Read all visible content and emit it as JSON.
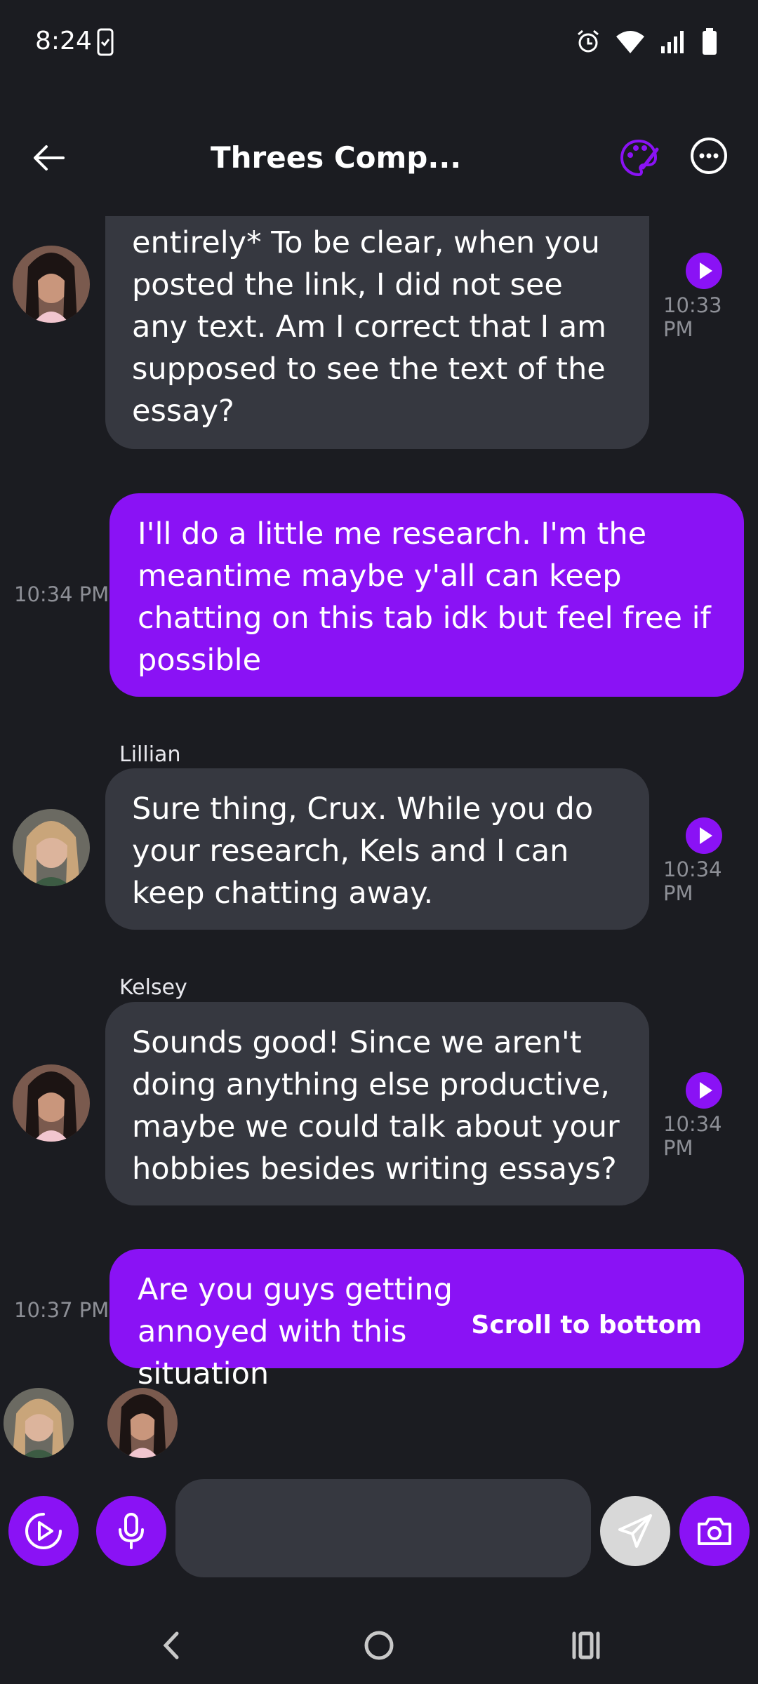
{
  "status_bar": {
    "time": "8:24"
  },
  "header": {
    "title": "Threes Comp..."
  },
  "messages": [
    {
      "role": "ai",
      "sender": "",
      "text": "entirely* To be clear, when you posted the link, I did not see any text. Am I correct that I am supposed to see the text of the essay?",
      "time": "10:33 PM"
    },
    {
      "role": "me",
      "text": "I'll do a little me research. I'm the meantime maybe y'all can keep chatting on this tab idk but feel free if possible",
      "time": "10:34 PM"
    },
    {
      "role": "ai",
      "sender": "Lillian",
      "text": "Sure thing, Crux. While you do your research, Kels and I can keep chatting away.",
      "time": "10:34 PM"
    },
    {
      "role": "ai",
      "sender": "Kelsey",
      "text": "Sounds good! Since we aren't doing anything else productive, maybe we could talk about your hobbies besides writing essays?",
      "time": "10:34 PM"
    },
    {
      "role": "me",
      "text": "Are you guys getting annoyed with this situation",
      "time": "10:37 PM"
    }
  ],
  "scroll_to_bottom_label": "Scroll to bottom",
  "composer": {
    "placeholder": ""
  },
  "colors": {
    "accent": "#8a12f5",
    "ai_bubble": "#363840",
    "background": "#1b1c21"
  }
}
